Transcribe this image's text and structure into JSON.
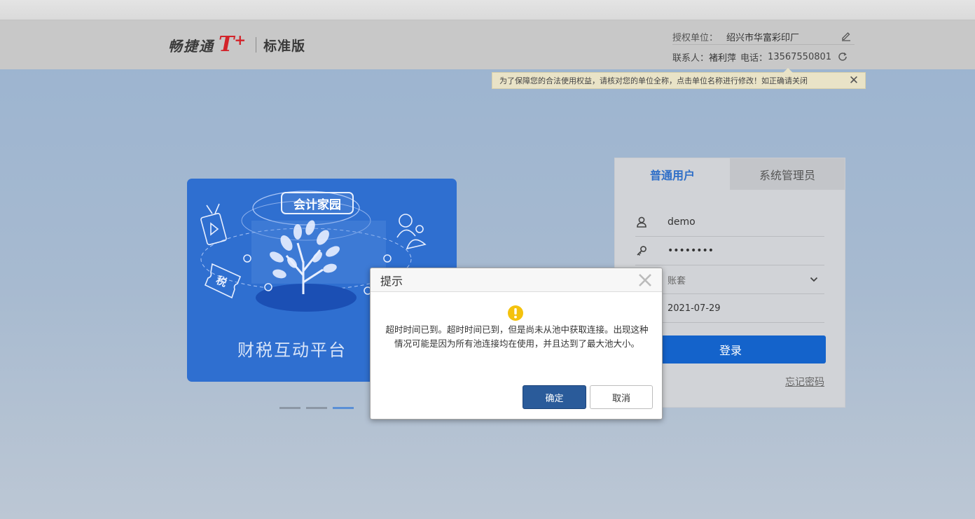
{
  "header": {
    "logo_text": "畅捷通",
    "logo_mark": "T",
    "logo_plus": "+",
    "edition": "标准版",
    "org_label": "授权单位：",
    "org_name": "绍兴市华富彩印厂",
    "contact_label": "联系人：",
    "contact_name": "褚利萍",
    "phone_label": "电话：",
    "phone": "13567550801"
  },
  "notice": {
    "text": "为了保障您的合法使用权益，请核对您的单位全称，点击单位名称进行修改！如正确请关闭"
  },
  "banner": {
    "tag": "会计家园",
    "tax_label": "税",
    "caption": "财税互动平台",
    "slides": 3,
    "active_slide": 3
  },
  "login": {
    "tabs": [
      "普通用户",
      "系统管理员"
    ],
    "active_tab": 0,
    "username": "demo",
    "password_mask": "••••••••",
    "account_set_placeholder": "账套",
    "date": "2021-07-29",
    "login_button": "登录",
    "forgot_link": "忘记密码"
  },
  "modal": {
    "title": "提示",
    "message": "超时时间已到。超时时间已到，但是尚未从池中获取连接。出现这种情况可能是因为所有池连接均在使用，并且达到了最大池大小。",
    "ok_label": "确定",
    "cancel_label": "取消"
  },
  "colors": {
    "accent": "#1463cb",
    "banner": "#2f6fd0",
    "warning": "#f4c20d",
    "brand_red": "#d3232a"
  },
  "icons": {
    "edit": "edit-icon",
    "refresh": "refresh-icon",
    "user": "user-icon",
    "key": "key-icon",
    "chevron": "chevron-down-icon",
    "warning": "warning-icon",
    "close": "close-icon"
  }
}
